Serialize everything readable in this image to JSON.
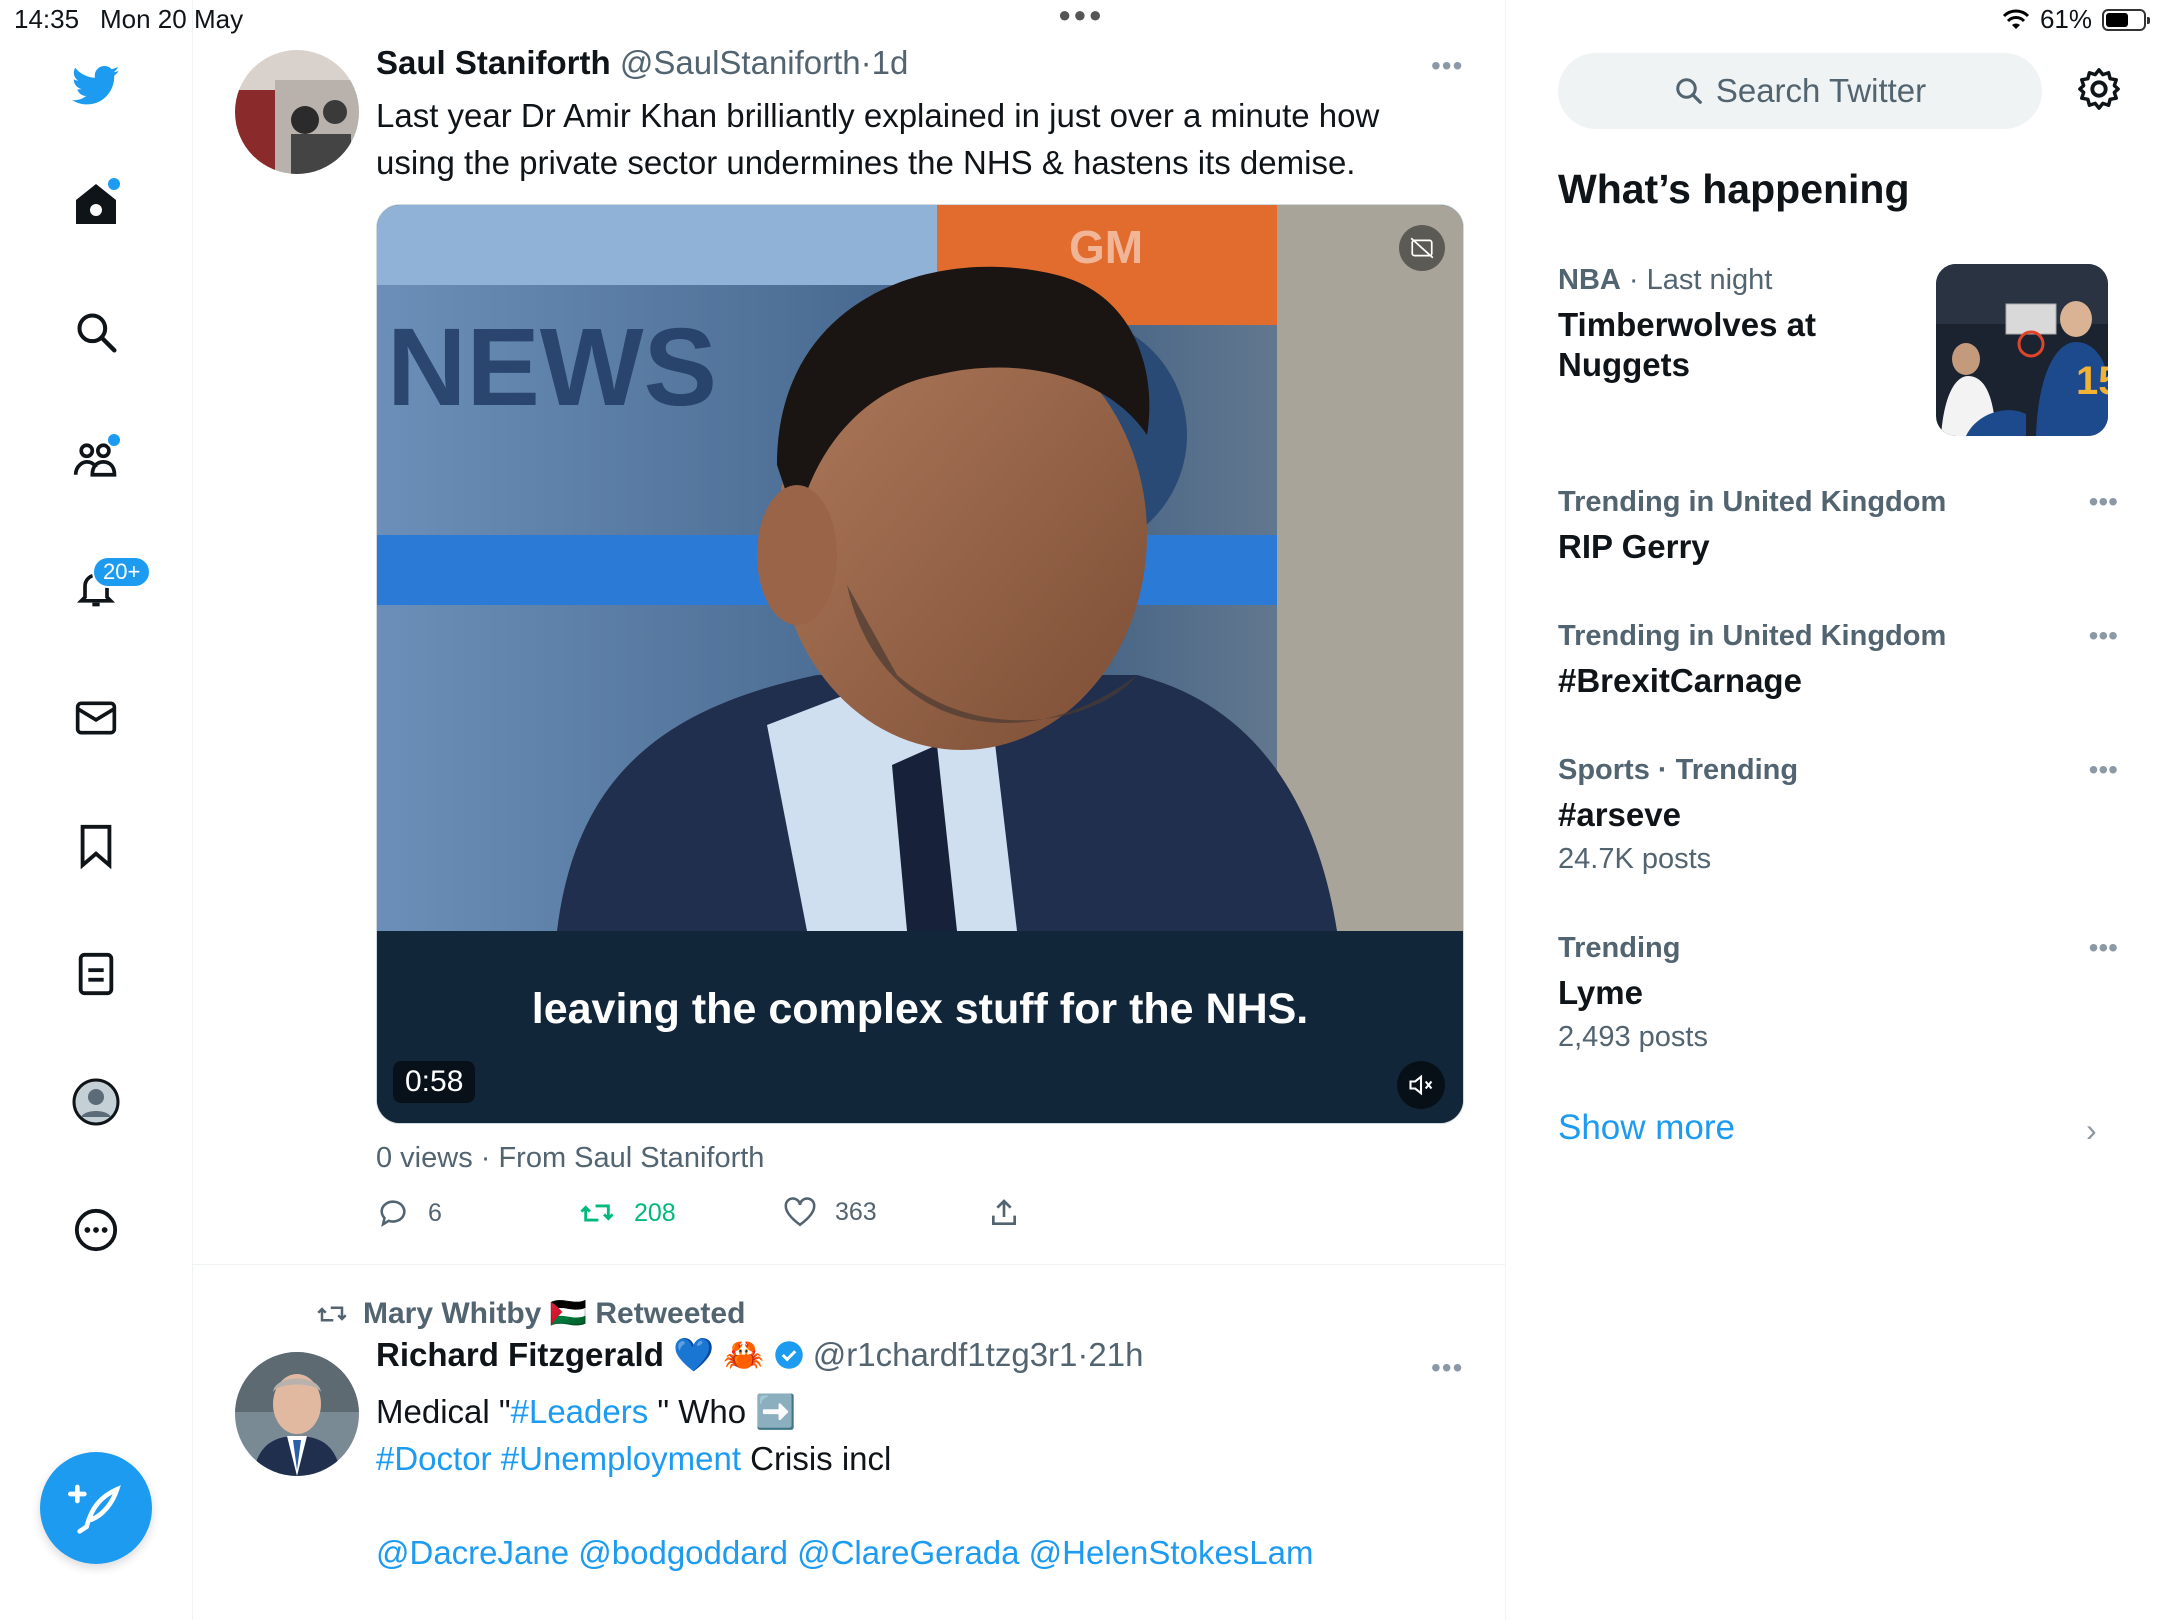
{
  "status_bar": {
    "time": "14:35",
    "date": "Mon 20 May",
    "battery": "61%",
    "battery_level": 0.61
  },
  "nav": {
    "notifications_badge": "20+",
    "items": [
      "home",
      "explore",
      "communities",
      "notifications",
      "messages",
      "bookmarks",
      "lists",
      "profile",
      "more"
    ]
  },
  "tweet1": {
    "name": "Saul Staniforth",
    "handle": "@SaulStaniforth",
    "sep": "·",
    "time": "1d",
    "text_line1": "Last year Dr Amir Khan brilliantly explained in just over a minute how",
    "text_line2": "using the private sector undermines the NHS & hastens its demise.",
    "video": {
      "caption": "leaving the complex stuff for the NHS.",
      "duration": "0:58",
      "overlay_logo": "GM",
      "bg_word": "NEWS"
    },
    "views": "0 views · From Saul Staniforth",
    "replies": "6",
    "retweets": "208",
    "likes": "363"
  },
  "tweet2": {
    "retweeted_by": "Mary Whitby 🇵🇸 Retweeted",
    "name": "Richard Fitzgerald",
    "emojis": "💙 🦀",
    "handle": "@r1chardf1tzg3r1",
    "sep": "·",
    "time": "21h",
    "line1_a": "Medical \"",
    "line1_tag": "#Leaders",
    "line1_b": " \" Who ➡️",
    "line2_tags": "#Doctor #Unemployment",
    "line2_rest": " Crisis incl",
    "mentions": "@DacreJane @bodgoddard @ClareGerada @HelenStokesLam"
  },
  "sidebar": {
    "search_placeholder": "Search Twitter",
    "title": "What’s happening",
    "trends": [
      {
        "meta_a": "NBA",
        "meta_b": " · Last night",
        "name": "Timberwolves at Nuggets",
        "count": ""
      },
      {
        "meta_a": "Trending in United Kingdom",
        "meta_b": "",
        "name": "RIP Gerry",
        "count": ""
      },
      {
        "meta_a": "Trending in United Kingdom",
        "meta_b": "",
        "name": "#BrexitCarnage",
        "count": ""
      },
      {
        "meta_a": "Sports · Trending",
        "meta_b": "",
        "name": "#arseve",
        "count": "24.7K posts"
      },
      {
        "meta_a": "Trending",
        "meta_b": "",
        "name": "Lyme",
        "count": "2,493 posts"
      }
    ],
    "show_more": "Show more"
  },
  "colors": {
    "accent": "#1d9bf0",
    "retweet_green": "#00ba7c",
    "muted": "#536471"
  }
}
